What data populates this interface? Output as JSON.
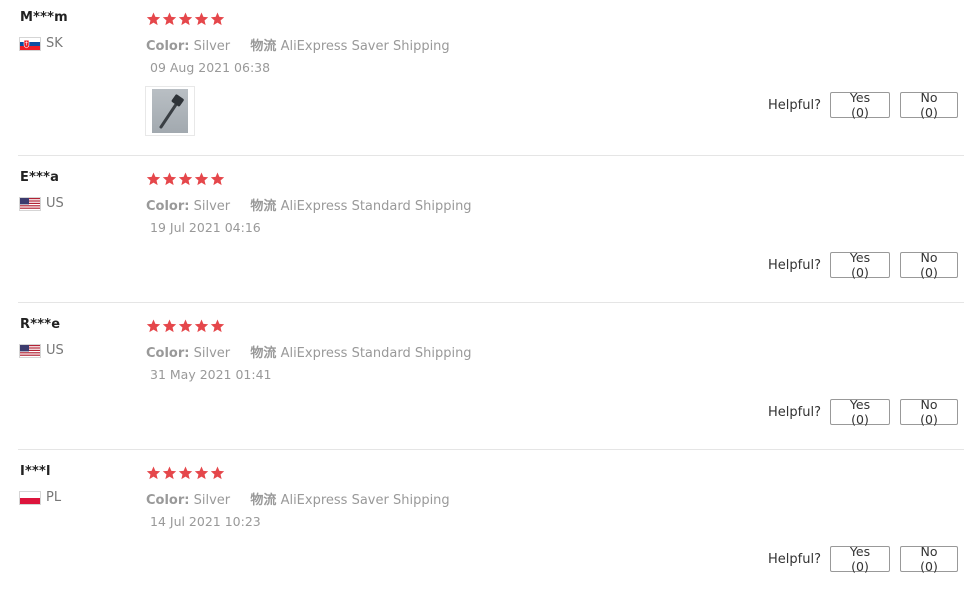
{
  "colors": {
    "star": "#e5474b",
    "text_muted": "#999999",
    "divider": "#e5e5e5"
  },
  "reviews": [
    {
      "user": "M***m",
      "country": "SK",
      "rating": 5,
      "color_label": "Color:",
      "color_value": "Silver",
      "shipping_label": "物流",
      "shipping_value": "AliExpress Saver Shipping",
      "date": "09 Aug 2021 06:38",
      "has_image": true,
      "helpful_label": "Helpful?",
      "yes_label": "Yes (0)",
      "no_label": "No (0)"
    },
    {
      "user": "E***a",
      "country": "US",
      "rating": 5,
      "color_label": "Color:",
      "color_value": "Silver",
      "shipping_label": "物流",
      "shipping_value": "AliExpress Standard Shipping",
      "date": "19 Jul 2021 04:16",
      "has_image": false,
      "helpful_label": "Helpful?",
      "yes_label": "Yes (0)",
      "no_label": "No (0)"
    },
    {
      "user": "R***e",
      "country": "US",
      "rating": 5,
      "color_label": "Color:",
      "color_value": "Silver",
      "shipping_label": "物流",
      "shipping_value": "AliExpress Standard Shipping",
      "date": "31 May 2021 01:41",
      "has_image": false,
      "helpful_label": "Helpful?",
      "yes_label": "Yes (0)",
      "no_label": "No (0)"
    },
    {
      "user": "I***l",
      "country": "PL",
      "rating": 5,
      "color_label": "Color:",
      "color_value": "Silver",
      "shipping_label": "物流",
      "shipping_value": "AliExpress Saver Shipping",
      "date": "14 Jul 2021 10:23",
      "has_image": false,
      "helpful_label": "Helpful?",
      "yes_label": "Yes (0)",
      "no_label": "No (0)"
    }
  ]
}
